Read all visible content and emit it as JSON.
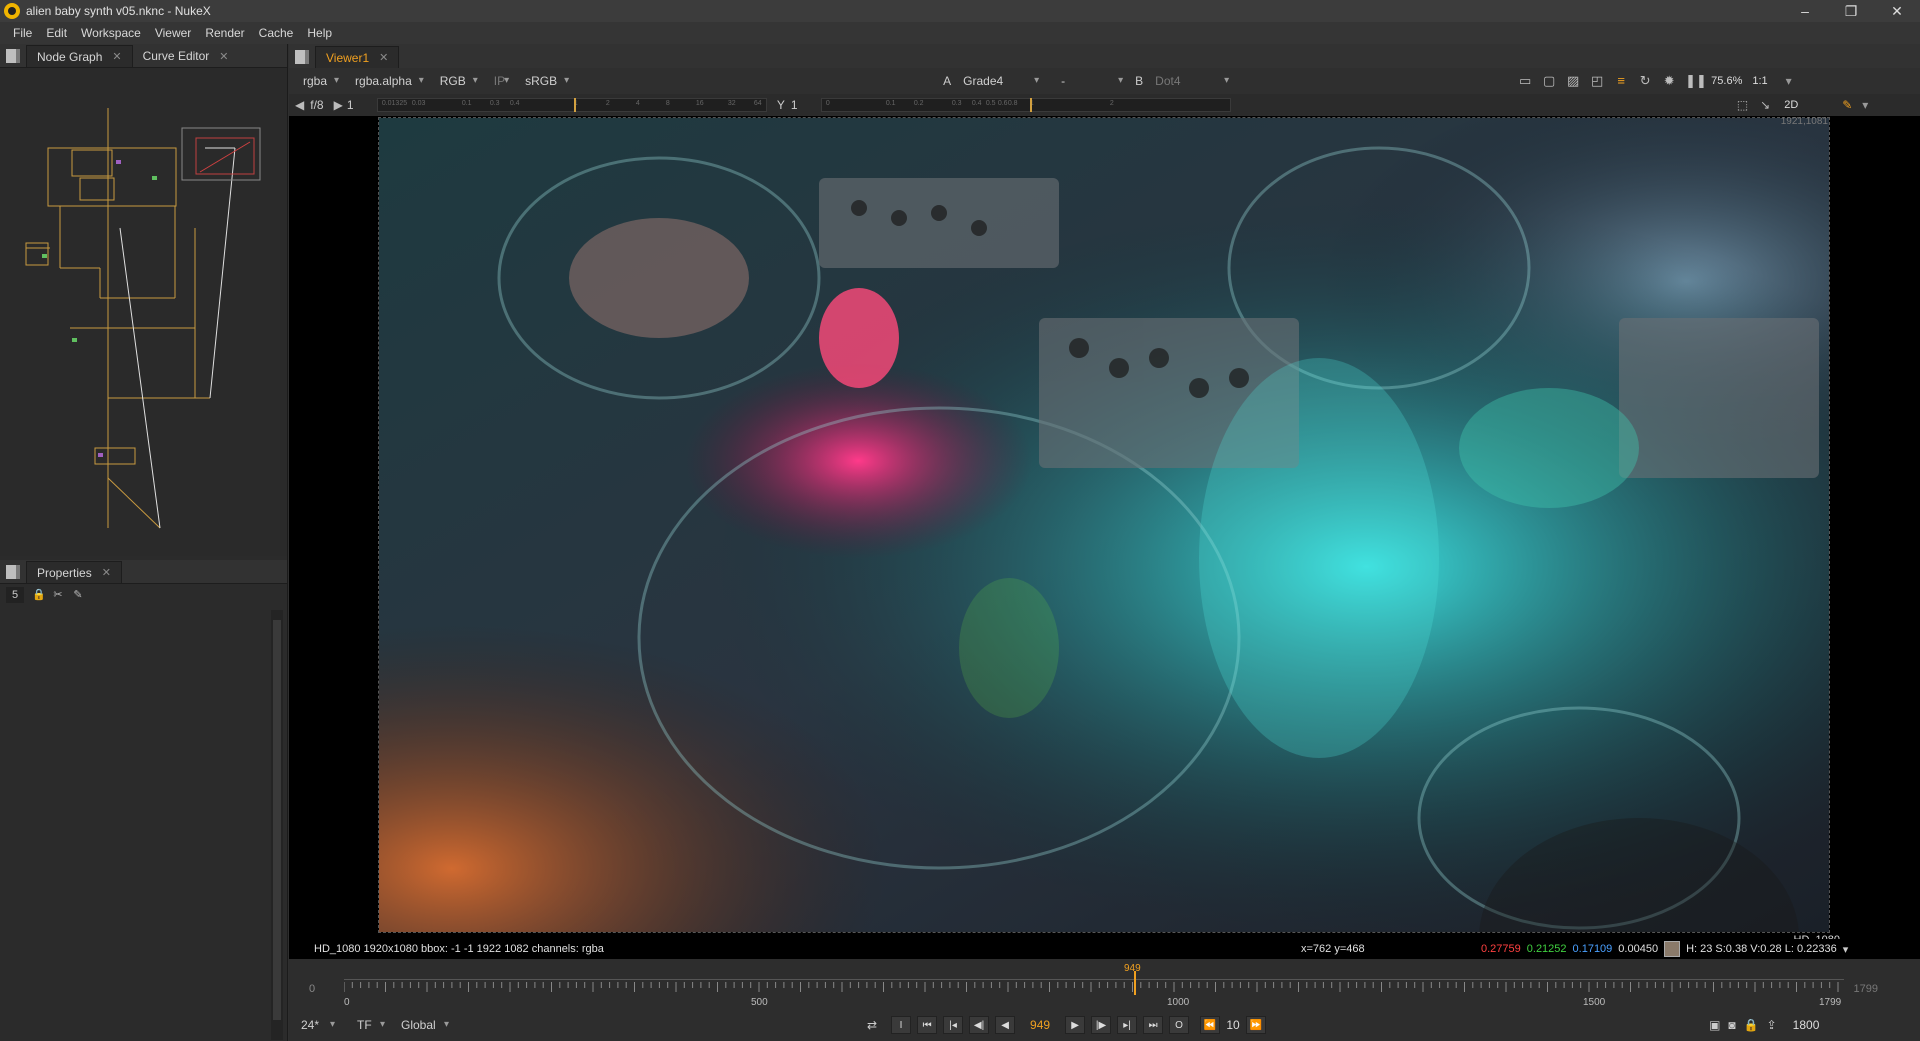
{
  "window": {
    "title": "alien baby synth v05.nknc - NukeX",
    "controls": [
      "–",
      "❐",
      "✕"
    ]
  },
  "menu": [
    "File",
    "Edit",
    "Workspace",
    "Viewer",
    "Render",
    "Cache",
    "Help"
  ],
  "left_tabs": {
    "node_graph": "Node Graph",
    "curve_editor": "Curve Editor",
    "properties": "Properties"
  },
  "properties": {
    "count": "5"
  },
  "viewer": {
    "tab": "Viewer1",
    "channels": "rgba",
    "alpha_channel": "rgba.alpha",
    "display": "RGB",
    "ip": "IP",
    "lut": "sRGB",
    "input_a_label": "A",
    "input_a": "Grade4",
    "compare_op": "-",
    "input_b_label": "B",
    "input_b": "Dot4",
    "zoom": "75.6%",
    "proxy": "1:1",
    "fstop": "f/8",
    "gain": "1",
    "gamma_label": "Y",
    "gamma": "1",
    "view_mode": "2D",
    "res_topright": "1921,1081",
    "format_label": "HD_1080",
    "ruler_marks": [
      "0.01325",
      "0.03",
      "0.1",
      "0.3",
      "0.4",
      "1",
      "2",
      "4",
      "8",
      "16",
      "32",
      "64"
    ],
    "ruler2_marks": [
      "0",
      "0.1",
      "0.2",
      "0.3",
      "0.4",
      "0.5",
      "0.6",
      "0.8",
      "1",
      "2"
    ]
  },
  "info": {
    "format": "HD_1080 1920x1080  bbox: -1 -1 1922 1082 channels: rgba",
    "coords": "x=762 y=468",
    "r": "0.27759",
    "g": "0.21252",
    "b": "0.17109",
    "a": "0.00450",
    "hsv": "H: 23 S:0.38 V:0.28  L: 0.22336",
    "colors": {
      "r": "#ff4040",
      "g": "#40d040",
      "b": "#4aa0ff"
    }
  },
  "timeline": {
    "start": "0",
    "end_value": "1799",
    "labels": [
      "0",
      "500",
      "1000",
      "1500",
      "1799"
    ],
    "current_frame": "949",
    "fps": "24*",
    "tf": "TF",
    "range": "Global",
    "increment": "10",
    "end_frame": "1800"
  }
}
